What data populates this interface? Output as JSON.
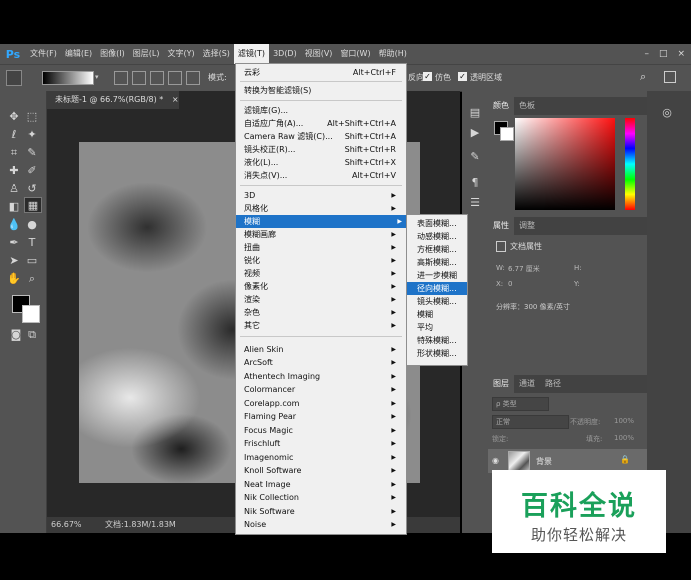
{
  "app": {
    "logo": "Ps"
  },
  "menubar": {
    "items": [
      "文件(F)",
      "编辑(E)",
      "图像(I)",
      "图层(L)",
      "文字(Y)",
      "选择(S)",
      "滤镜(T)",
      "3D(D)",
      "视图(V)",
      "窗口(W)",
      "帮助(H)"
    ],
    "active": "滤镜(T)",
    "window_controls": [
      "–",
      "□",
      "×"
    ]
  },
  "options_bar": {
    "mode_label": "模式:",
    "reverse_label": "反向",
    "dither_label": "仿色",
    "transparency_label": "透明区域"
  },
  "document": {
    "tab_title": "未标题-1 @ 66.7%(RGB/8) *",
    "close": "×",
    "zoom": "66.67%",
    "doc_info": "文档:1.83M/1.83M"
  },
  "filter_menu": {
    "top_items": [
      {
        "label": "云彩",
        "shortcut": "Alt+Ctrl+F"
      },
      {
        "label": "转换为智能滤镜(S)",
        "shortcut": ""
      }
    ],
    "gallery_items": [
      {
        "label": "滤镜库(G)...",
        "shortcut": ""
      },
      {
        "label": "自适应广角(A)...",
        "shortcut": "Alt+Shift+Ctrl+A"
      },
      {
        "label": "Camera Raw 滤镜(C)...",
        "shortcut": "Shift+Ctrl+A"
      },
      {
        "label": "镜头校正(R)...",
        "shortcut": "Shift+Ctrl+R"
      },
      {
        "label": "液化(L)...",
        "shortcut": "Shift+Ctrl+X"
      },
      {
        "label": "消失点(V)...",
        "shortcut": "Alt+Ctrl+V"
      }
    ],
    "filter_groups": [
      "3D",
      "风格化",
      "模糊",
      "模糊画廊",
      "扭曲",
      "锐化",
      "视频",
      "像素化",
      "渲染",
      "杂色",
      "其它"
    ],
    "highlighted_group": "模糊",
    "plugins": [
      "Alien Skin",
      "ArcSoft",
      "Athentech Imaging",
      "Colormancer",
      "Corelapp.com",
      "Flaming Pear",
      "Focus Magic",
      "Frischluft",
      "Imagenomic",
      "Knoll Software",
      "Neat Image",
      "Nik Collection",
      "Nik Software",
      "Noise"
    ]
  },
  "blur_submenu": {
    "items": [
      "表面模糊...",
      "动感模糊...",
      "方框模糊...",
      "高斯模糊...",
      "进一步模糊",
      "径向模糊...",
      "镜头模糊...",
      "模糊",
      "平均",
      "特殊模糊...",
      "形状模糊..."
    ],
    "highlighted": "径向模糊..."
  },
  "color_panel": {
    "tabs": [
      "颜色",
      "色板"
    ]
  },
  "properties_panel": {
    "tabs": [
      "属性",
      "调整"
    ],
    "heading": "文档属性",
    "w_label": "W:",
    "w_value": "6.77 厘米",
    "h_label": "H:",
    "x_label": "X:",
    "x_value": "0",
    "y_label": "Y:",
    "resolution": "分辨率：300 像素/英寸"
  },
  "layers_panel": {
    "tabs": [
      "图层",
      "通道",
      "路径"
    ],
    "kind_filter": "ρ 类型",
    "blend_mode": "正常",
    "opacity_label": "不透明度:",
    "opacity_value": "100%",
    "lock_label": "锁定:",
    "fill_label": "填充:",
    "fill_value": "100%",
    "layer_name": "背景"
  },
  "watermark": {
    "title": "百科全说",
    "subtitle": "助你轻松解决"
  },
  "colors": {
    "highlight": "#1e73c8",
    "panel": "#535353",
    "watermark_green": "#1aa05a"
  }
}
